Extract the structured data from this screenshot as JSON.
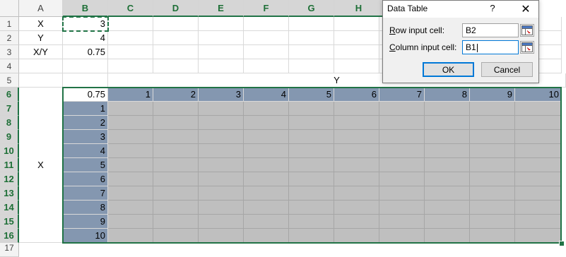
{
  "columns": [
    "A",
    "B",
    "C",
    "D",
    "E",
    "F",
    "G",
    "H"
  ],
  "selected_columns": [
    "B",
    "C",
    "D",
    "E",
    "F",
    "G",
    "H"
  ],
  "rows": [
    "1",
    "2",
    "3",
    "4",
    "5",
    "6",
    "7",
    "8",
    "9",
    "10",
    "11",
    "12",
    "13",
    "14",
    "15",
    "16",
    "17"
  ],
  "selected_rows": [
    "6",
    "7",
    "8",
    "9",
    "10",
    "11",
    "12",
    "13",
    "14",
    "15",
    "16"
  ],
  "cells": {
    "A1": "X",
    "B1": "3",
    "A2": "Y",
    "B2": "4",
    "A3": "X/Y",
    "B3": "0.75",
    "Y_label": "Y",
    "X_label": "X",
    "B6": "0.75"
  },
  "table_header_values": [
    "1",
    "2",
    "3",
    "4",
    "5",
    "6",
    "7",
    "8",
    "9",
    "10"
  ],
  "table_row_values": [
    "1",
    "2",
    "3",
    "4",
    "5",
    "6",
    "7",
    "8",
    "9",
    "10"
  ],
  "dialog": {
    "title": "Data Table",
    "help": "?",
    "close": "✕",
    "row_input_label": "Row input cell:",
    "row_input_value": "B2",
    "column_input_label": "Column input cell:",
    "column_input_value": "B1",
    "ok_label": "OK",
    "cancel_label": "Cancel",
    "range_icon": "range-select-icon"
  },
  "colors": {
    "accent": "#217346",
    "table_header_fill": "#8497b0",
    "table_body_fill": "#bfbfbf",
    "dialog_focus": "#0078d7"
  }
}
